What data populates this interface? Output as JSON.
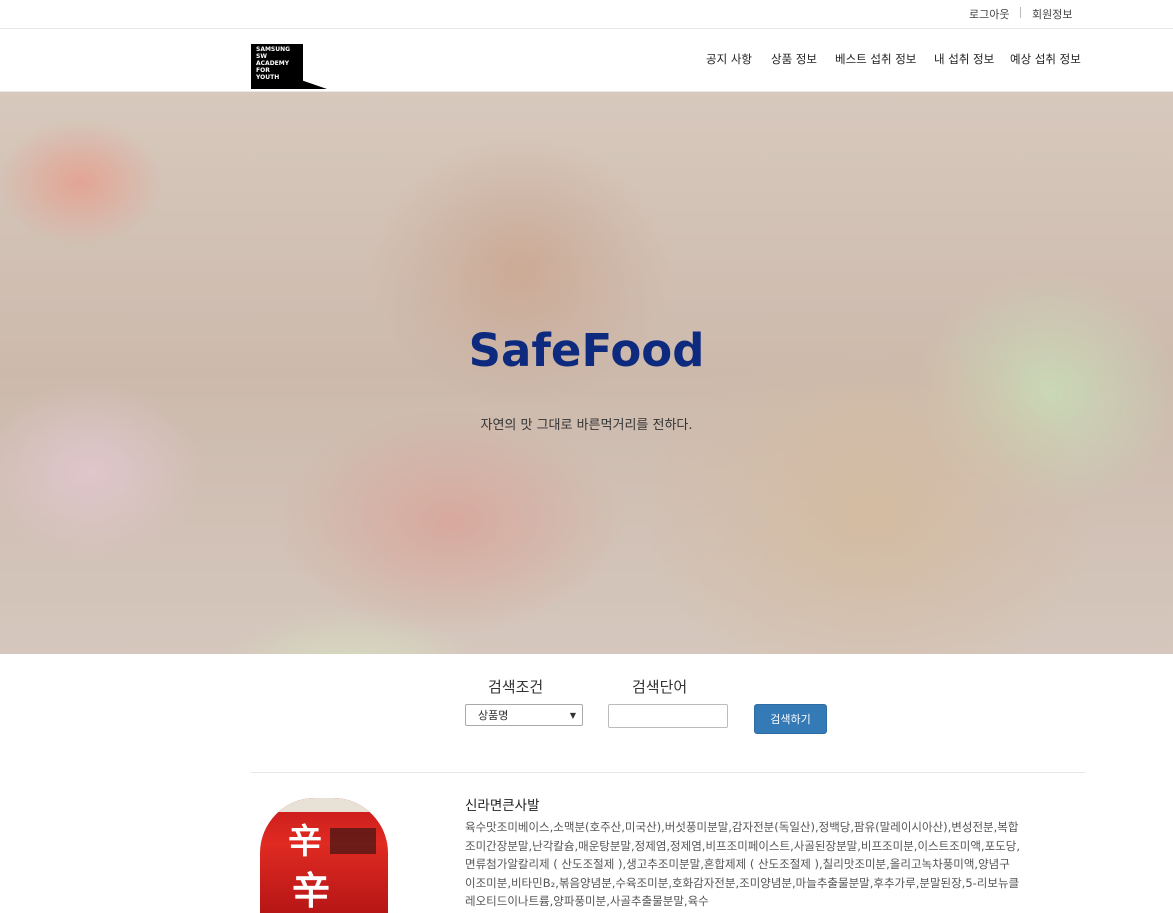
{
  "topbar": {
    "logout": "로그아웃",
    "member_info": "회원정보"
  },
  "logo": {
    "text_lines": [
      "SAMSUNG",
      "SW",
      "ACADEMY",
      "FOR",
      "YOUTH"
    ]
  },
  "nav": {
    "items": [
      {
        "label": "공지 사항"
      },
      {
        "label": "상품 정보"
      },
      {
        "label": "베스트 섭취 정보"
      },
      {
        "label": "내 섭취 정보"
      },
      {
        "label": "예상 섭취 정보"
      }
    ]
  },
  "hero": {
    "title": "SafeFood",
    "subtitle": "자연의 맛 그대로 바른먹거리를 전하다."
  },
  "search": {
    "condition_label": "검색조건",
    "keyword_label": "검색단어",
    "condition_selected": "상품명",
    "keyword_value": "",
    "button_label": "검색하기"
  },
  "products": [
    {
      "name": "신라면큰사발",
      "description": "육수맛조미베이스,소맥분(호주산,미국산),버섯풍미분말,감자전분(독일산),정백당,팜유(말레이시아산),변성전분,복합조미간장분말,난각칼슘,매운탕분말,정제염,정제염,비프조미페이스트,사골된장분말,비프조미분,이스트조미액,포도당,면류첨가알칼리제 ( 산도조절제 ),생고추조미분말,혼합제제 ( 산도조절제 ),칠리맛조미분,올리고녹차풍미액,양념구이조미분,비타민B₂,볶음양념분,수육조미분,호화감자전분,조미양념분,마늘추출물분말,후추가루,분말된장,5-리보뉴클레오티드이나트륨,양파풍미분,사골추출물분말,육수"
    }
  ]
}
